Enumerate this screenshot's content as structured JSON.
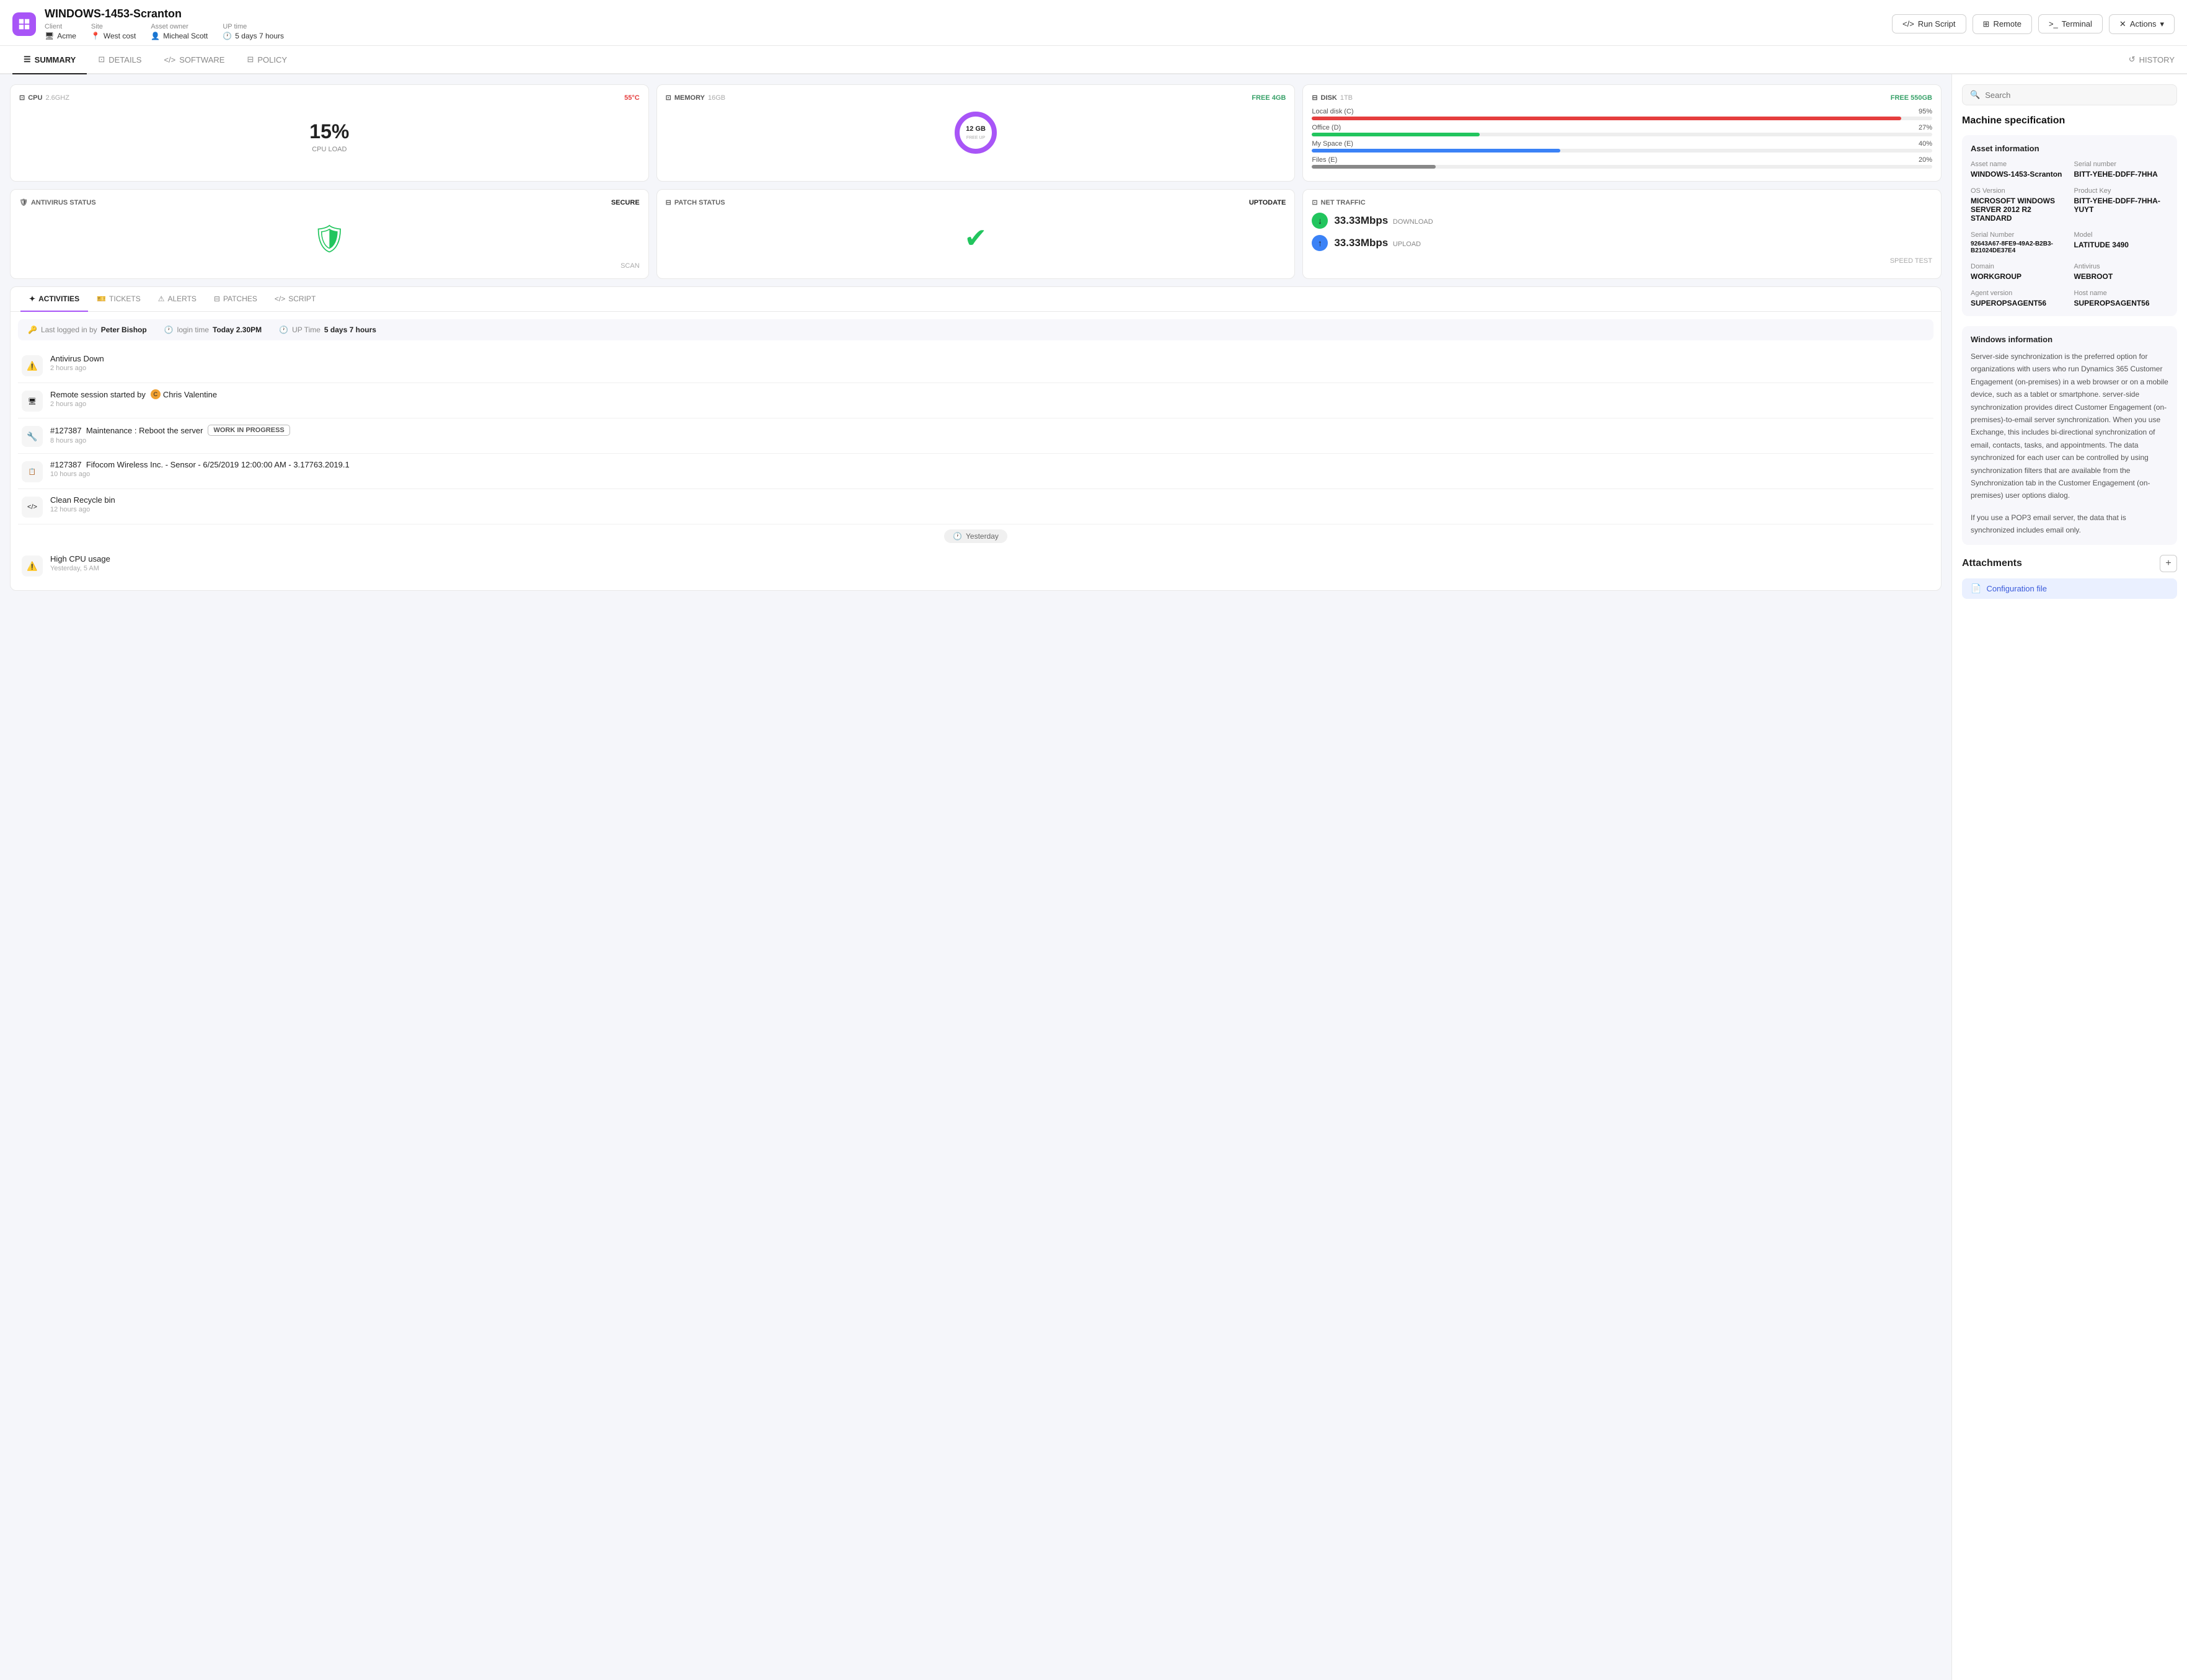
{
  "header": {
    "device_name": "WINDOWS-1453-Scranton",
    "client_label": "Client",
    "client_val": "Acme",
    "site_label": "Site",
    "site_val": "West cost",
    "owner_label": "Asset owner",
    "owner_val": "Micheal Scott",
    "uptime_label": "UP time",
    "uptime_val": "5 days 7 hours",
    "btn_run_script": "Run Script",
    "btn_remote": "Remote",
    "btn_terminal": "Terminal",
    "btn_actions": "Actions"
  },
  "tabs": {
    "items": [
      {
        "label": "SUMMARY",
        "active": true
      },
      {
        "label": "DETAILS",
        "active": false
      },
      {
        "label": "SOFTWARE",
        "active": false
      },
      {
        "label": "POLICY",
        "active": false
      }
    ],
    "history": "HISTORY"
  },
  "cpu": {
    "title": "CPU",
    "freq": "2.6GHZ",
    "temp": "55°C",
    "load_percent": "15%",
    "load_label": "CPU LOAD"
  },
  "memory": {
    "title": "MEMORY",
    "total": "16GB",
    "free_label": "FREE",
    "free_val": "4GB",
    "used_gb": "12 GB",
    "free_up_label": "FREE UP",
    "used_percent": 75
  },
  "disk": {
    "title": "DISK",
    "total": "1TB",
    "free_label": "FREE",
    "free_val": "550GB",
    "items": [
      {
        "name": "Local disk (C)",
        "percent": 95,
        "color": "#e53e3e"
      },
      {
        "name": "Office (D)",
        "percent": 27,
        "color": "#22c55e"
      },
      {
        "name": "My Space (E)",
        "percent": 40,
        "color": "#3b82f6"
      },
      {
        "name": "Files (E)",
        "percent": 20,
        "color": "#888"
      }
    ]
  },
  "antivirus": {
    "title": "ANTIVIRUS STATUS",
    "status": "SECURE",
    "footer": "SCAN"
  },
  "patch": {
    "title": "PATCH STATUS",
    "status": "UPTODATE"
  },
  "net": {
    "title": "NET TRAFFIC",
    "download_speed": "33.33Mbps",
    "download_label": "DOWNLOAD",
    "upload_speed": "33.33Mbps",
    "upload_label": "UPLOAD",
    "footer": "SPEED TEST"
  },
  "activity_tabs": [
    {
      "label": "ACTIVITIES",
      "active": true
    },
    {
      "label": "TICKETS",
      "active": false
    },
    {
      "label": "ALERTS",
      "active": false
    },
    {
      "label": "PATCHES",
      "active": false
    },
    {
      "label": "SCRIPT",
      "active": false
    }
  ],
  "session": {
    "logged_by_label": "Last logged in by",
    "logged_by_val": "Peter Bishop",
    "login_time_label": "login time",
    "login_time_val": "Today 2.30PM",
    "uptime_label": "UP Time",
    "uptime_val": "5 days 7 hours"
  },
  "activities": [
    {
      "icon": "⚠️",
      "title": "Antivirus Down",
      "time": "2 hours ago",
      "badge": null
    },
    {
      "icon": "🖥️",
      "title": "Remote session started by  Chris Valentine",
      "time": "2 hours ago",
      "badge": null,
      "has_avatar": true
    },
    {
      "icon": "🔧",
      "title": "#127387  Maintenance : Reboot the server",
      "time": "8 hours ago",
      "badge": "WORK IN PROGRESS"
    },
    {
      "icon": "📋",
      "title": "#127387  Fifocom Wireless Inc. - Sensor - 6/25/2019 12:00:00 AM - 3.17763.2019.1",
      "time": "10 hours ago",
      "badge": null
    },
    {
      "icon": "</>",
      "title": "Clean Recycle bin",
      "time": "12 hours ago",
      "badge": null
    }
  ],
  "yesterday_activities": [
    {
      "icon": "⚠️",
      "title": "High CPU usage",
      "time": "Yesterday, 5 AM",
      "badge": null
    }
  ],
  "right_panel": {
    "search_placeholder": "Search",
    "machine_spec_title": "Machine specification",
    "asset_section_title": "Asset information",
    "asset_name_label": "Asset name",
    "asset_name_val": "WINDOWS-1453-Scranton",
    "serial_label": "Serial number",
    "serial_val": "BITT-YEHE-DDFF-7HHA",
    "os_label": "OS Version",
    "os_val": "MICROSOFT WINDOWS SERVER 2012 R2 STANDARD",
    "product_key_label": "Product Key",
    "product_key_val": "BITT-YEHE-DDFF-7HHA-YUYT",
    "serial_num_label": "Serial Number",
    "serial_num_val": "92643A67-8FE9-49A2-B2B3-B21024DE37E4",
    "model_label": "Model",
    "model_val": "LATITUDE 3490",
    "domain_label": "Domain",
    "domain_val": "WORKGROUP",
    "antivirus_label": "Antivirus",
    "antivirus_val": "WEBROOT",
    "agent_label": "Agent version",
    "agent_val": "SUPEROPSAGENT56",
    "hostname_label": "Host name",
    "hostname_val": "SUPEROPSAGENT56",
    "win_section_title": "Windows information",
    "win_text": "Server-side synchronization is the preferred option for organizations with users who run Dynamics 365 Customer Engagement (on-premises) in a web browser or on a mobile device, such as a tablet or smartphone. server-side synchronization provides direct Customer Engagement (on-premises)-to-email server synchronization. When you use Exchange, this includes bi-directional synchronization of email, contacts, tasks, and appointments. The data synchronized for each user can be controlled by using synchronization filters that are available from the Synchronization tab in the Customer Engagement (on-premises) user options dialog.",
    "win_text2": "If you use a POP3 email server, the data that is synchronized includes email only.",
    "attachments_title": "Attachments",
    "attach_file_label": "Configuration file"
  }
}
